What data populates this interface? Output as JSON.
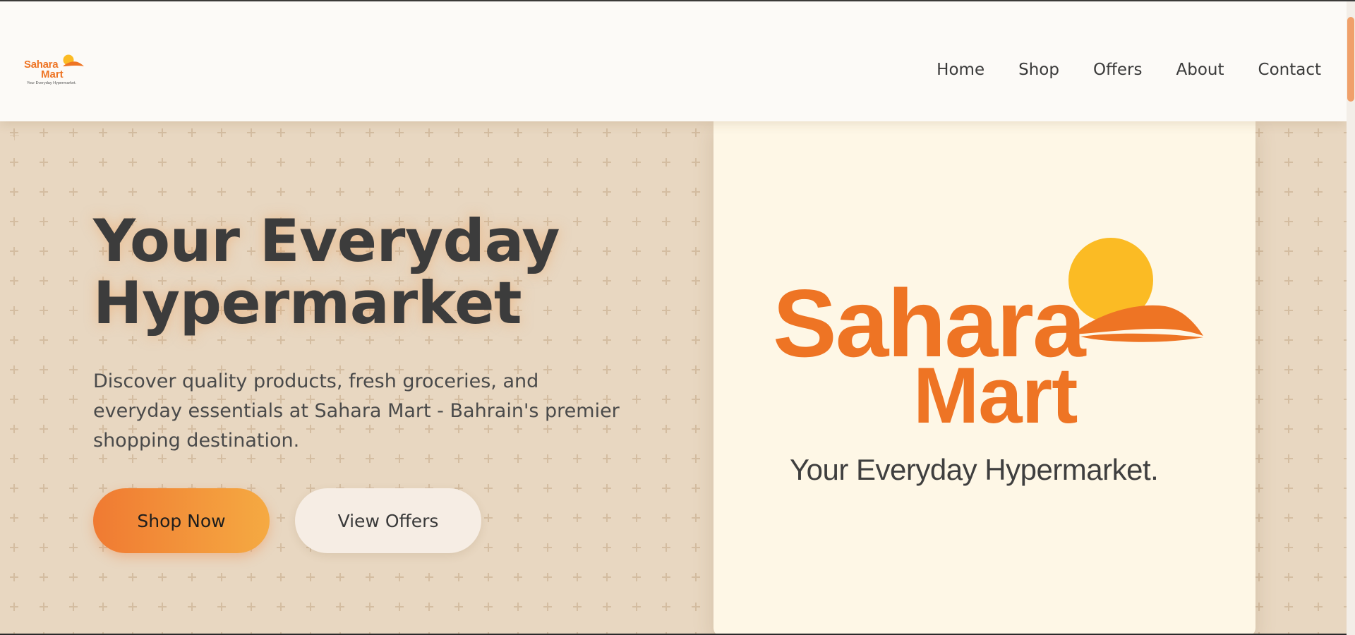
{
  "brand": {
    "name_line1": "Sahara",
    "name_line2": "Mart",
    "tagline_small": "Your Everyday Hypermarket.",
    "tagline_large": "Your Everyday Hypermarket.",
    "primary_color": "#ee7424",
    "sun_color": "#fbbb24"
  },
  "nav": {
    "items": [
      {
        "label": "Home"
      },
      {
        "label": "Shop"
      },
      {
        "label": "Offers"
      },
      {
        "label": "About"
      },
      {
        "label": "Contact"
      }
    ]
  },
  "hero": {
    "title_line1": "Your Everyday",
    "title_line2": "Hypermarket",
    "description": "Discover quality products, fresh groceries, and everyday essentials at Sahara Mart - Bahrain's premier shopping destination.",
    "primary_button": "Shop Now",
    "secondary_button": "View Offers"
  },
  "colors": {
    "page_background": "#e8d6c0",
    "header_background": "#fcfaf7",
    "card_background": "#fef7e6",
    "text_dark": "#3c3c3c",
    "button_gradient_start": "#f07a32",
    "button_gradient_end": "#f5aa42"
  },
  "icons": {
    "logo_mark": "sun-over-dune-icon"
  }
}
